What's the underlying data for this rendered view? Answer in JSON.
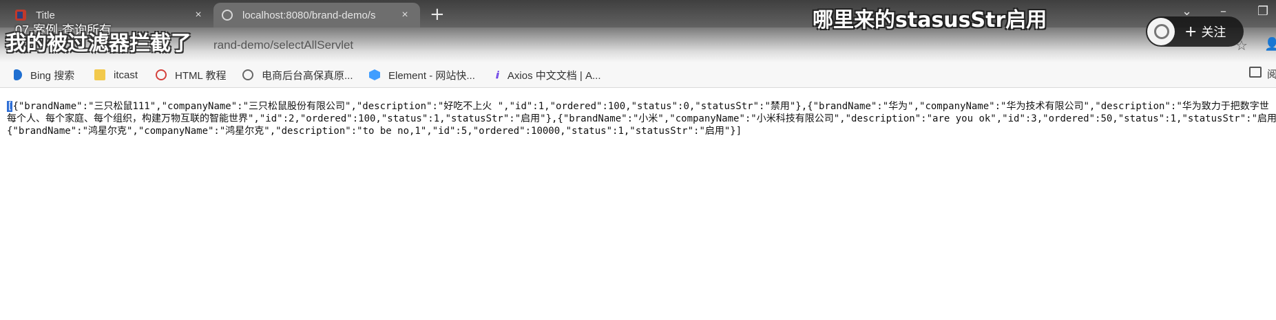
{
  "browser": {
    "tabs": [
      {
        "title": "Title",
        "icon": "idea-logo-icon",
        "active": false
      },
      {
        "title": "localhost:8080/brand-demo/s",
        "icon": "globe-icon",
        "active": true
      }
    ],
    "close_symbol": "×",
    "new_tab_symbol": "+",
    "address": "rand-demo/selectAllServlet",
    "bookmarks": [
      {
        "label": "Bing 搜索",
        "icon": "bing-icon"
      },
      {
        "label": "itcast",
        "icon": "folder-icon"
      },
      {
        "label": "HTML 教程",
        "icon": "html-tutorial-icon"
      },
      {
        "label": "电商后台高保真原...",
        "icon": "globe-icon"
      },
      {
        "label": "Element - 网站快...",
        "icon": "element-icon"
      },
      {
        "label": "Axios 中文文档 | A...",
        "icon": "axios-icon"
      }
    ],
    "reader_label": "阅"
  },
  "overlay": {
    "course_title": "07-案例-查询所有",
    "subtitle": "我的被过滤器拦截了",
    "question": "哪里来的stasusStr启用",
    "follow_label": "关注",
    "follow_symbol": "+"
  },
  "page": {
    "cursor_char": "[",
    "json_lines": [
      "{\"brandName\":\"三只松鼠111\",\"companyName\":\"三只松鼠股份有限公司\",\"description\":\"好吃不上火 \",\"id\":1,\"ordered\":100,\"status\":0,\"statusStr\":\"禁用\"},{\"brandName\":\"华为\",\"companyName\":\"华为技术有限公司\",\"description\":\"华为致力于把数字世",
      "每个人、每个家庭、每个组织，构建万物互联的智能世界\",\"id\":2,\"ordered\":100,\"status\":1,\"statusStr\":\"启用\"},{\"brandName\":\"小米\",\"companyName\":\"小米科技有限公司\",\"description\":\"are you ok\",\"id\":3,\"ordered\":50,\"status\":1,\"statusStr\":\"启用",
      "{\"brandName\":\"鸿星尔克\",\"companyName\":\"鸿星尔克\",\"description\":\"to be no,1\",\"id\":5,\"ordered\":10000,\"status\":1,\"statusStr\":\"启用\"}]"
    ]
  }
}
